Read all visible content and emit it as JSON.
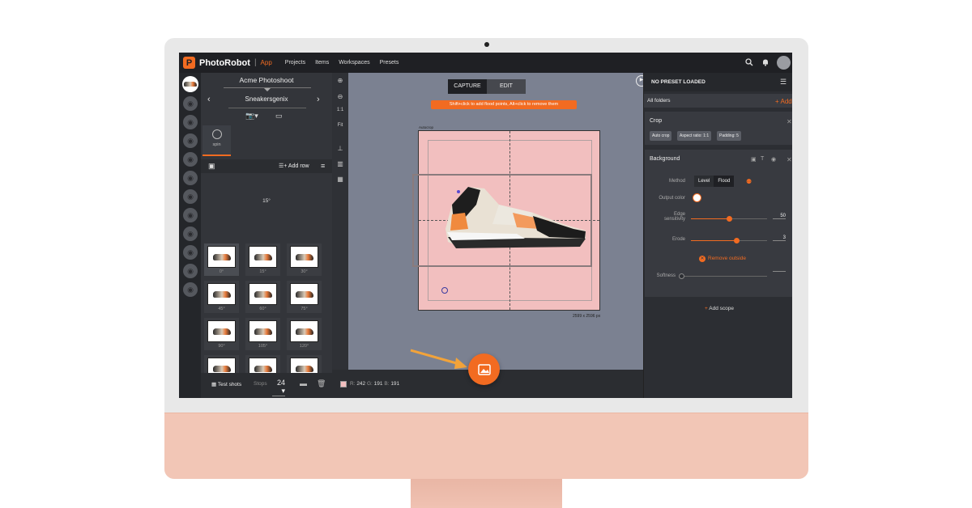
{
  "app": {
    "brand": "PhotoRobot",
    "mode": "App",
    "logo_letter": "P"
  },
  "nav": [
    "Projects",
    "Items",
    "Workspaces",
    "Presets"
  ],
  "left_panel": {
    "project": "Acme Photoshoot",
    "item": "Sneakersgenix",
    "tab_spin": "spin",
    "add_row": "Add row",
    "row_label": "15°",
    "frames": [
      "0°",
      "15°",
      "30°",
      "45°",
      "60°",
      "75°",
      "90°",
      "105°",
      "120°",
      "135°",
      "150°",
      "165°",
      "",
      "",
      ""
    ],
    "test_shots": "Test shots",
    "stops_label": "Stops",
    "stops_value": "24"
  },
  "tools": [
    "1:1",
    "Fit"
  ],
  "canvas": {
    "tab_capture": "CAPTURE",
    "tab_edit": "EDIT",
    "hint": "Shift+click to add flood points, Alt+click to remove them",
    "autocrop_label": "Autocrop",
    "dimensions": "2599 x 2596 px"
  },
  "status": {
    "r_label": "R:",
    "r": "242",
    "g_label": "G:",
    "g": "191",
    "b_label": "B:",
    "b": "191",
    "swatch": "#f2bfbf"
  },
  "right_panel": {
    "preset": "NO PRESET LOADED",
    "folders": "All folders",
    "add": "Add",
    "crop": {
      "title": "Crop",
      "chips": [
        "Auto crop",
        "Aspect ratio: 1:1",
        "Padding: 5"
      ]
    },
    "background": {
      "title": "Background",
      "method_label": "Method",
      "method_options": [
        "Level",
        "Flood"
      ],
      "method_selected": "Flood",
      "output_color_label": "Output color",
      "edge_label_1": "Edge",
      "edge_label_2": "sensitivity",
      "edge_value": "50",
      "edge_fraction": 0.5,
      "erode_label": "Erode",
      "erode_value": "3",
      "erode_fraction": 0.6,
      "remove_outside": "Remove outside",
      "softness_label": "Softness",
      "softness_value": "",
      "softness_fraction": 0.0
    },
    "add_scope": "Add scope"
  },
  "colors": {
    "accent": "#f26b21",
    "background_fill": "#f2bfbf",
    "monitor_chin": "#f2c6b6"
  }
}
